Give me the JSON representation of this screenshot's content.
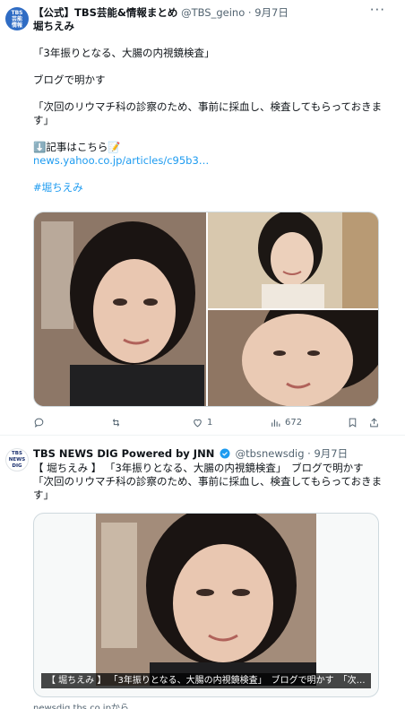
{
  "tweet1": {
    "avatar_text": "TBS\n芸能\n情報",
    "display_name": "【公式】TBS芸能&情報まとめ",
    "handle": "@TBS_geino",
    "separator": "·",
    "date": "9月7日",
    "more_icon": "more-dots-icon",
    "title_line": "堀ちえみ",
    "quote1": "「3年振りとなる、大腸の内視鏡検査」",
    "line2": "ブログで明かす",
    "quote2": "「次回のリウマチ科の診察のため、事前に採血し、検査してもらっておきます」",
    "article_prefix": "⬇️記事はこちら📝",
    "article_link": "news.yahoo.co.jp/articles/c95b3…",
    "hashtag": "#堀ちえみ",
    "actions": {
      "reply_count": "",
      "retweet_count": "",
      "like_count": "1",
      "views_count": "672"
    }
  },
  "tweet2": {
    "avatar_text": "TBS\nNEWS\nDIG",
    "display_name": "TBS NEWS DIG Powered by JNN",
    "handle": "@tbsnewsdig",
    "separator": "·",
    "date": "9月7日",
    "text_line1": "【 堀ちえみ 】 「3年振りとなる、大腸の内視鏡検査」　ブログで明かす",
    "text_line2": "「次回のリウマチ科の診察のため、事前に採血し、検査してもらっておきま",
    "text_line3": "す」",
    "card_caption": "【 堀ちえみ 】 「3年振りとなる、大腸の内視鏡検査」　ブログで明かす　「次…",
    "card_domain": "newsdig.tbs.co.jpから"
  },
  "colors": {
    "link": "#1d9bf0",
    "muted": "#536471",
    "verified": "#1d9bf0"
  }
}
